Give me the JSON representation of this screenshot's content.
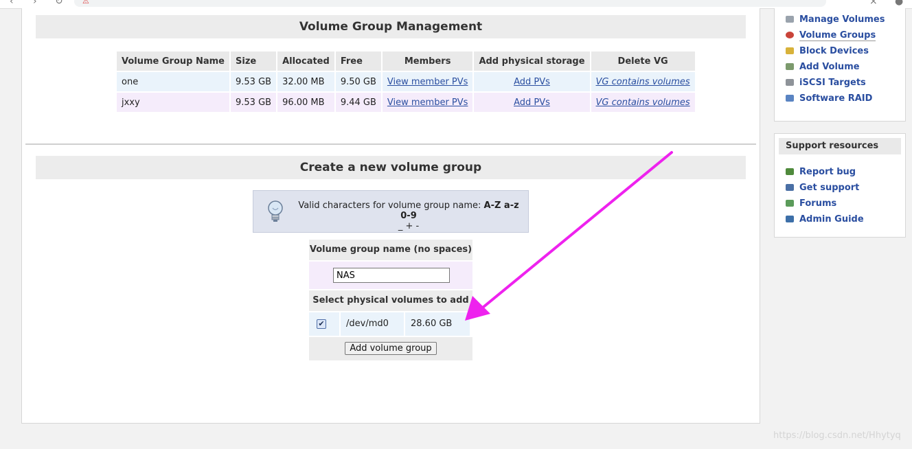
{
  "colors": {
    "link": "#2a4ea0",
    "header_bg": "#ececec",
    "row_blue": "#eaf3fb",
    "row_purple": "#f5ecfb",
    "arrow": "#ee22ee"
  },
  "vg_management": {
    "title": "Volume Group Management",
    "columns": [
      "Volume Group Name",
      "Size",
      "Allocated",
      "Free",
      "Members",
      "Add physical storage",
      "Delete VG"
    ],
    "rows": [
      {
        "name": "one",
        "size": "9.53 GB",
        "allocated": "32.00 MB",
        "free": "9.50 GB",
        "members": "View member PVs",
        "add": "Add PVs",
        "delete": "VG contains volumes"
      },
      {
        "name": "jxxy",
        "size": "9.53 GB",
        "allocated": "96.00 MB",
        "free": "9.44 GB",
        "members": "View member PVs",
        "add": "Add PVs",
        "delete": "VG contains volumes"
      }
    ]
  },
  "create_vg": {
    "title": "Create a new volume group",
    "info_icon": "lightbulb-icon",
    "info_prefix": "Valid characters for volume group name: ",
    "info_chars": "A-Z a-z 0-9",
    "info_chars2": "_ + -",
    "name_label": "Volume group name (no spaces)",
    "name_value": "NAS",
    "select_label": "Select physical volumes to add",
    "pv": {
      "checked": true,
      "device": "/dev/md0",
      "size": "28.60 GB"
    },
    "submit_label": "Add volume group"
  },
  "sidebar": {
    "items": [
      {
        "label": "Manage Volumes",
        "icon": "drive-icon"
      },
      {
        "label": "Volume Groups",
        "icon": "volume-groups-icon"
      },
      {
        "label": "Block Devices",
        "icon": "block-devices-icon"
      },
      {
        "label": "Add Volume",
        "icon": "add-volume-icon"
      },
      {
        "label": "iSCSI Targets",
        "icon": "iscsi-icon"
      },
      {
        "label": "Software RAID",
        "icon": "raid-icon"
      }
    ]
  },
  "support": {
    "title": "Support resources",
    "items": [
      {
        "label": "Report bug",
        "icon": "bug-icon"
      },
      {
        "label": "Get support",
        "icon": "support-icon"
      },
      {
        "label": "Forums",
        "icon": "forums-icon"
      },
      {
        "label": "Admin Guide",
        "icon": "book-icon"
      }
    ]
  },
  "watermark": "https://blog.csdn.net/Hhytyq"
}
